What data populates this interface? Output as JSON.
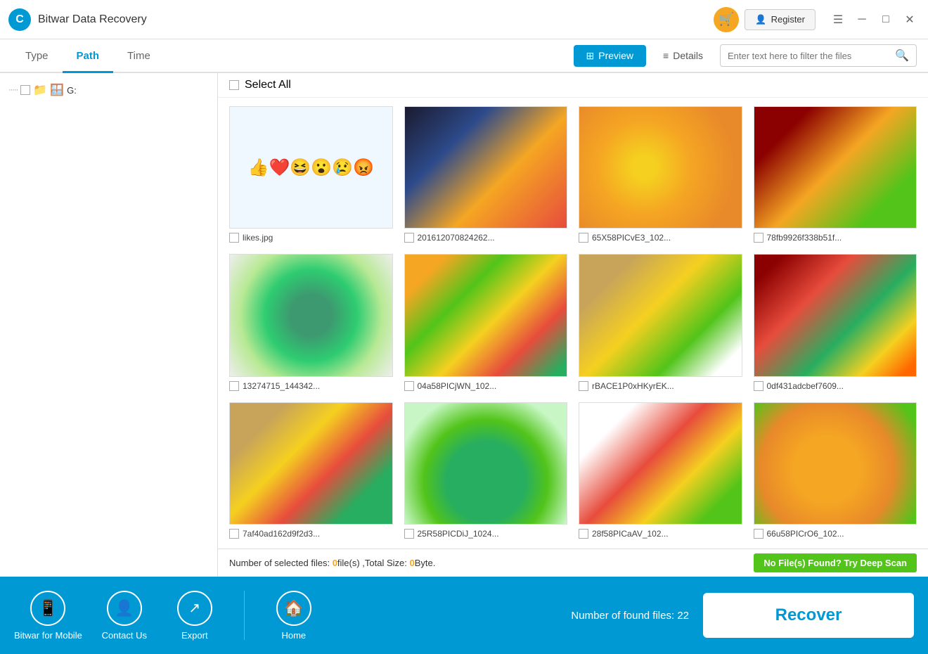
{
  "app": {
    "title": "Bitwar Data Recovery",
    "logo_letter": "C"
  },
  "titlebar": {
    "cart_icon": "🛒",
    "register_icon": "👤",
    "register_label": "Register",
    "menu_icon": "☰",
    "minimize_icon": "—",
    "maximize_icon": "□",
    "close_icon": "✕"
  },
  "tabs": {
    "items": [
      {
        "id": "type",
        "label": "Type",
        "active": false
      },
      {
        "id": "path",
        "label": "Path",
        "active": true
      },
      {
        "id": "time",
        "label": "Time",
        "active": false
      }
    ],
    "preview_label": "Preview",
    "details_label": "Details",
    "search_placeholder": "Enter text here to filter the files"
  },
  "sidebar": {
    "tree": [
      {
        "label": "G:"
      }
    ]
  },
  "grid": {
    "select_all_label": "Select All",
    "items": [
      {
        "id": 1,
        "name": "likes.jpg",
        "img_class": "img-likes",
        "emoji": "👍❤️😆😮😢😡"
      },
      {
        "id": 2,
        "name": "201612070824262...",
        "img_class": "img-fruit1",
        "emoji": ""
      },
      {
        "id": 3,
        "name": "65X58PICvE3_102...",
        "img_class": "img-orange",
        "emoji": ""
      },
      {
        "id": 4,
        "name": "78fb9926f338b51f...",
        "img_class": "img-kiwi-juice",
        "emoji": ""
      },
      {
        "id": 5,
        "name": "13274715_144342...",
        "img_class": "img-kiwi",
        "emoji": ""
      },
      {
        "id": 6,
        "name": "04a58PICjWN_102...",
        "img_class": "img-mixed",
        "emoji": ""
      },
      {
        "id": 7,
        "name": "rBACE1P0xHKyrEK...",
        "img_class": "img-cutting",
        "emoji": ""
      },
      {
        "id": 8,
        "name": "0df431adcbef7609...",
        "img_class": "img-berries",
        "emoji": ""
      },
      {
        "id": 9,
        "name": "7af40ad162d9f2d3...",
        "img_class": "img-berries2",
        "emoji": ""
      },
      {
        "id": 10,
        "name": "25R58PICDiJ_1024...",
        "img_class": "img-watermelon",
        "emoji": ""
      },
      {
        "id": 11,
        "name": "28f58PICaAV_102...",
        "img_class": "img-strawberry",
        "emoji": ""
      },
      {
        "id": 12,
        "name": "66u58PICrO6_102...",
        "img_class": "img-orange2",
        "emoji": ""
      }
    ]
  },
  "statusbar": {
    "prefix": "Number of selected files: ",
    "file_count": "0",
    "file_unit": "file(s) ,Total Size: ",
    "size": "0",
    "size_unit": "Byte.",
    "deep_scan_label": "No File(s) Found? Try Deep Scan"
  },
  "bottombar": {
    "actions": [
      {
        "id": "mobile",
        "icon": "📱",
        "label": "Bitwar for Mobile"
      },
      {
        "id": "contact",
        "icon": "👤",
        "label": "Contact Us"
      },
      {
        "id": "export",
        "icon": "↗",
        "label": "Export"
      }
    ],
    "home_icon": "🏠",
    "home_label": "Home",
    "found_label": "Number of found files: 22",
    "recover_label": "Recover"
  }
}
